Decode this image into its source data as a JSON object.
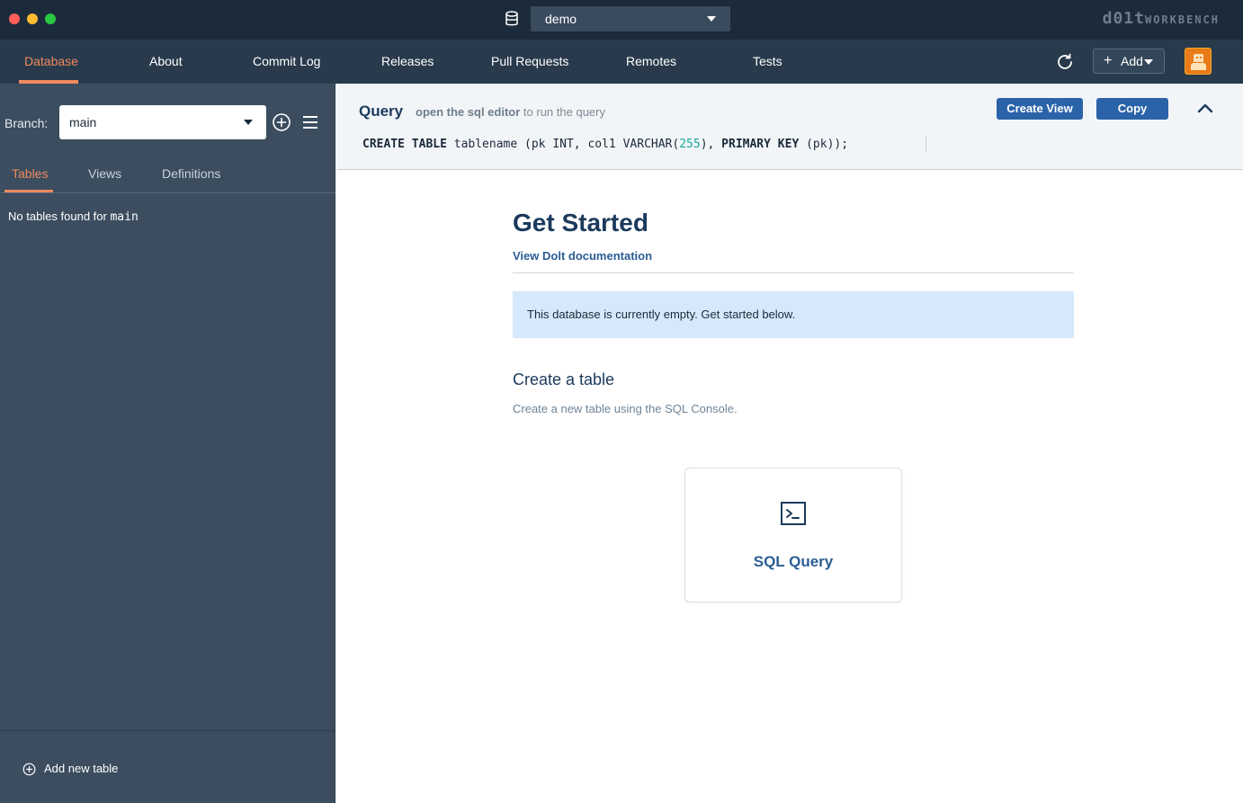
{
  "window": {
    "database_selector": {
      "value": "demo"
    },
    "brand": {
      "logo_text": "d01t",
      "sub_text": "WORKBENCH"
    }
  },
  "nav": {
    "tabs": [
      {
        "label": "Database",
        "active": true
      },
      {
        "label": "About",
        "active": false
      },
      {
        "label": "Commit Log",
        "active": false
      },
      {
        "label": "Releases",
        "active": false
      },
      {
        "label": "Pull Requests",
        "active": false
      },
      {
        "label": "Remotes",
        "active": false
      },
      {
        "label": "Tests",
        "active": false
      }
    ],
    "add_label": "Add",
    "add_plus": "+"
  },
  "sidebar": {
    "branch_label": "Branch:",
    "branch_value": "main",
    "tabs": [
      {
        "label": "Tables",
        "active": true
      },
      {
        "label": "Views",
        "active": false
      },
      {
        "label": "Definitions",
        "active": false
      }
    ],
    "empty_text": "No tables found for",
    "empty_branch": "main",
    "add_table_label": "Add new table"
  },
  "query": {
    "title": "Query",
    "hint_link": "open the sql editor",
    "hint_rest": "to run the query",
    "sql": {
      "kw1": "CREATE TABLE",
      "t1": " tablename (pk INT, col1 VARCHAR(",
      "num": "255",
      "t2": "), ",
      "kw2": "PRIMARY KEY",
      "t3": " (pk));"
    },
    "create_view_label": "Create View",
    "copy_label": "Copy"
  },
  "main": {
    "title": "Get Started",
    "doc_link": "View Dolt documentation",
    "info": "This database is currently empty. Get started below.",
    "section_title": "Create a table",
    "section_desc": "Create a new table using the SQL Console.",
    "card_label": "SQL Query"
  },
  "colors": {
    "titlebar": "#1c2b3b",
    "navbar": "#283a4c",
    "sidebar": "#3b4d5f",
    "accent": "#f08a5d",
    "primary_button": "#2a63a8",
    "info_banner": "#d6e8fb"
  }
}
